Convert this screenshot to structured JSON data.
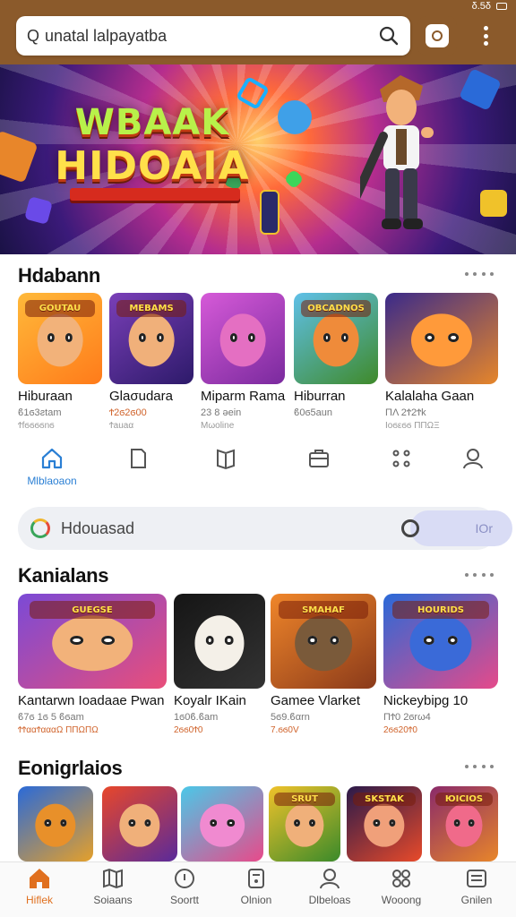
{
  "header": {
    "search_text": "unatal lalpayatba",
    "status": "δ.5δ"
  },
  "hero": {
    "title_line1": "WBAAK",
    "title_line2": "HIDOAIA"
  },
  "section1": {
    "title": "Hdabann",
    "items": [
      {
        "name": "Hiburaan",
        "sub": "ϐ1ϭ3ƨtam",
        "sub2": "Ϯfϭϭϭϭnϭ",
        "banner": "GOUTAU",
        "colors": [
          "#ffb93a",
          "#ff7b1a"
        ],
        "face": "#f2b27a"
      },
      {
        "name": "Glaσudara",
        "sub": "Ϯ2ϭ2ϭ00",
        "sub2": "Ϯauaα",
        "banner": "MEBAMS",
        "colors": [
          "#7a3fb8",
          "#2d1a6a"
        ],
        "face": "#f0b07a"
      },
      {
        "name": "Miparm Rama",
        "sub": "23 8 ǝein",
        "sub2": "Mωoline",
        "banner": "",
        "colors": [
          "#d65ad8",
          "#7a2a9e"
        ],
        "face": "#e46fc2"
      },
      {
        "name": "Hiburran",
        "sub": "ϐ0ϭ5aun",
        "sub2": "",
        "banner": "OBCADNOS",
        "colors": [
          "#5fc0e8",
          "#3f8a2a"
        ],
        "face": "#ef8b3a"
      },
      {
        "name": "Kalalaha Gaan",
        "sub": "ΠΛ 2Ϯ2Ϯk",
        "sub2": "Ιoϭεϭϭ ΠΠΩΞ",
        "banner": "",
        "colors": [
          "#3a2a8a",
          "#e6862a"
        ],
        "face": "#ff9a3a"
      }
    ]
  },
  "midnav": {
    "items": [
      {
        "label": "Mlblaoaon",
        "icon": "home-icon"
      },
      {
        "label": "",
        "icon": "document-icon"
      },
      {
        "label": "",
        "icon": "book-icon"
      },
      {
        "label": "",
        "icon": "briefcase-icon"
      },
      {
        "label": "",
        "icon": "apps-icon"
      },
      {
        "label": "",
        "icon": "user-icon"
      }
    ]
  },
  "search2": {
    "text": "Hdouasad",
    "pill": "ΙOr"
  },
  "section2": {
    "title": "Kanialans",
    "items": [
      {
        "name": "Kantarwn Ioadaae Pwan",
        "sub": "ϐ7ϭ 1ϭ 5 ϐϭam",
        "sub2": "ϮϮααϮαααΩ ΠΠΩΠΩ",
        "banner": "GUEGSE",
        "colors": [
          "#7b4ad6",
          "#e94e7a"
        ],
        "face": "#f2b27a"
      },
      {
        "name": "Koyalr IKain",
        "sub": "1ϭ0ϐ.ϐam",
        "sub2": "2ϭϭ0Ϯ0",
        "banner": "",
        "colors": [
          "#151515",
          "#333333"
        ],
        "face": "#f4f0e8"
      },
      {
        "name": "Gamee Vlarket",
        "sub": "5ϭ9.ϐαrn",
        "sub2": "7.ϭϭ0V",
        "banner": "SMAHAF",
        "colors": [
          "#f0862a",
          "#8a3a1a"
        ],
        "face": "#7a5a3a"
      },
      {
        "name": "Nickeybipg 10",
        "sub": "ΠϮ0 2ϭrω4",
        "sub2": "2ϭϭ20Ϯ0",
        "banner": "HOURIDS",
        "colors": [
          "#2a6ad8",
          "#e54a8a"
        ],
        "face": "#3a6ad8"
      }
    ]
  },
  "section3": {
    "title": "Eonigrlaios",
    "items": [
      {
        "banner": "",
        "colors": [
          "#2a6ad8",
          "#e5a02a"
        ],
        "face": "#e8902a"
      },
      {
        "banner": "",
        "colors": [
          "#e8472a",
          "#5a2a9a"
        ],
        "face": "#f0b07a"
      },
      {
        "banner": "",
        "colors": [
          "#4ac8e8",
          "#e84a8a"
        ],
        "face": "#f08ad0"
      },
      {
        "banner": "SRUT",
        "colors": [
          "#f0c22a",
          "#3a8a2a"
        ],
        "face": "#f0b07a"
      },
      {
        "banner": "SKSTAK",
        "colors": [
          "#2a1a4a",
          "#e84a2a"
        ],
        "face": "#f0a07a"
      },
      {
        "banner": "ЮICIOS",
        "colors": [
          "#8a2a6a",
          "#e8862a"
        ],
        "face": "#f06a8a"
      }
    ]
  },
  "bottomnav": {
    "items": [
      {
        "label": "Hiflek",
        "icon": "home-icon",
        "active": true
      },
      {
        "label": "Soiaans",
        "icon": "map-icon"
      },
      {
        "label": "Soortt",
        "icon": "compass-icon"
      },
      {
        "label": "Olnion",
        "icon": "calculator-icon"
      },
      {
        "label": "Dlbeloas",
        "icon": "person-icon"
      },
      {
        "label": "Wooong",
        "icon": "gamepad-icon"
      },
      {
        "label": "Gnilen",
        "icon": "list-icon"
      }
    ]
  },
  "colors": {
    "accent": "#e0701f",
    "brand": "#8b5a2b",
    "link": "#2a7fd4"
  }
}
